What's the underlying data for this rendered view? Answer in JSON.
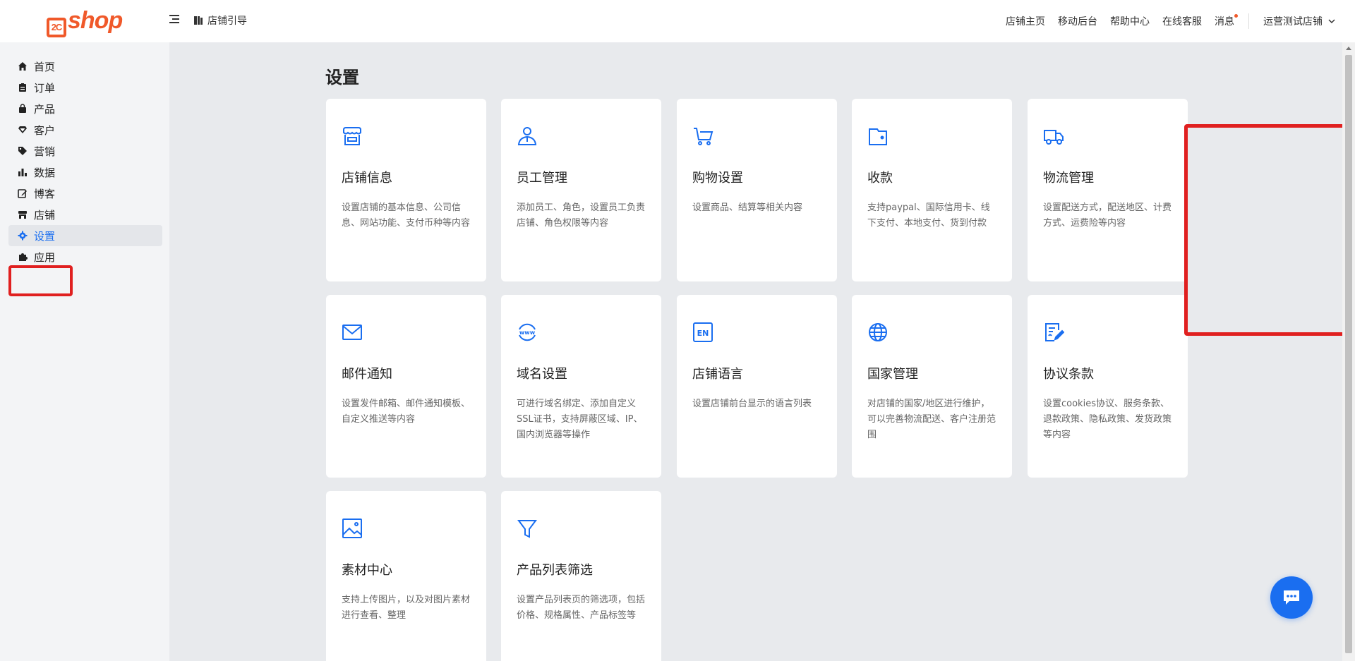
{
  "header": {
    "logo_text": "shop",
    "logo_mark": "2C",
    "guide_label": "店铺引导",
    "nav": [
      "店铺主页",
      "移动后台",
      "帮助中心",
      "在线客服",
      "消息"
    ],
    "store_name": "运营测试店铺"
  },
  "sidebar": {
    "items": [
      {
        "label": "首页",
        "icon": "home-icon"
      },
      {
        "label": "订单",
        "icon": "clipboard-icon"
      },
      {
        "label": "产品",
        "icon": "bag-icon"
      },
      {
        "label": "客户",
        "icon": "diamond-icon"
      },
      {
        "label": "营销",
        "icon": "tag-icon"
      },
      {
        "label": "数据",
        "icon": "bar-chart-icon"
      },
      {
        "label": "博客",
        "icon": "edit-icon"
      },
      {
        "label": "店铺",
        "icon": "store-icon"
      },
      {
        "label": "设置",
        "icon": "gear-icon",
        "active": true
      },
      {
        "label": "应用",
        "icon": "puzzle-icon"
      }
    ]
  },
  "main": {
    "title": "设置",
    "cards": [
      {
        "title": "店铺信息",
        "desc": "设置店铺的基本信息、公司信息、网站功能、支付币种等内容",
        "icon": "storefront-icon"
      },
      {
        "title": "员工管理",
        "desc": "添加员工、角色，设置员工负责店铺、角色权限等内容",
        "icon": "staff-icon"
      },
      {
        "title": "购物设置",
        "desc": "设置商品、结算等相关内容",
        "icon": "cart-icon"
      },
      {
        "title": "收款",
        "desc": "支持paypal、国际信用卡、线下支付、本地支付、货到付款",
        "icon": "wallet-icon"
      },
      {
        "title": "物流管理",
        "desc": "设置配送方式，配送地区、计费方式、运费险等内容",
        "icon": "truck-icon"
      },
      {
        "title": "邮件通知",
        "desc": "设置发件邮箱、邮件通知模板、自定义推送等内容",
        "icon": "mail-icon"
      },
      {
        "title": "域名设置",
        "desc": "可进行域名绑定、添加自定义SSL证书，支持屏蔽区域、IP、国内浏览器等操作",
        "icon": "www-icon"
      },
      {
        "title": "店铺语言",
        "desc": "设置店铺前台显示的语言列表",
        "icon": "language-en-icon"
      },
      {
        "title": "国家管理",
        "desc": "对店铺的国家/地区进行维护，可以完善物流配送、客户注册范围",
        "icon": "globe-icon"
      },
      {
        "title": "协议条款",
        "desc": "设置cookies协议、服务条款、退款政策、隐私政策、发货政策等内容",
        "icon": "document-sign-icon"
      },
      {
        "title": "素材中心",
        "desc": "支持上传图片，以及对图片素材进行查看、整理",
        "icon": "image-icon"
      },
      {
        "title": "产品列表筛选",
        "desc": "设置产品列表页的筛选项，包括价格、规格属性、产品标签等",
        "icon": "filter-icon"
      }
    ]
  },
  "colors": {
    "accent": "#1a6ef0",
    "brand": "#f0592a",
    "highlight": "#e02020"
  }
}
